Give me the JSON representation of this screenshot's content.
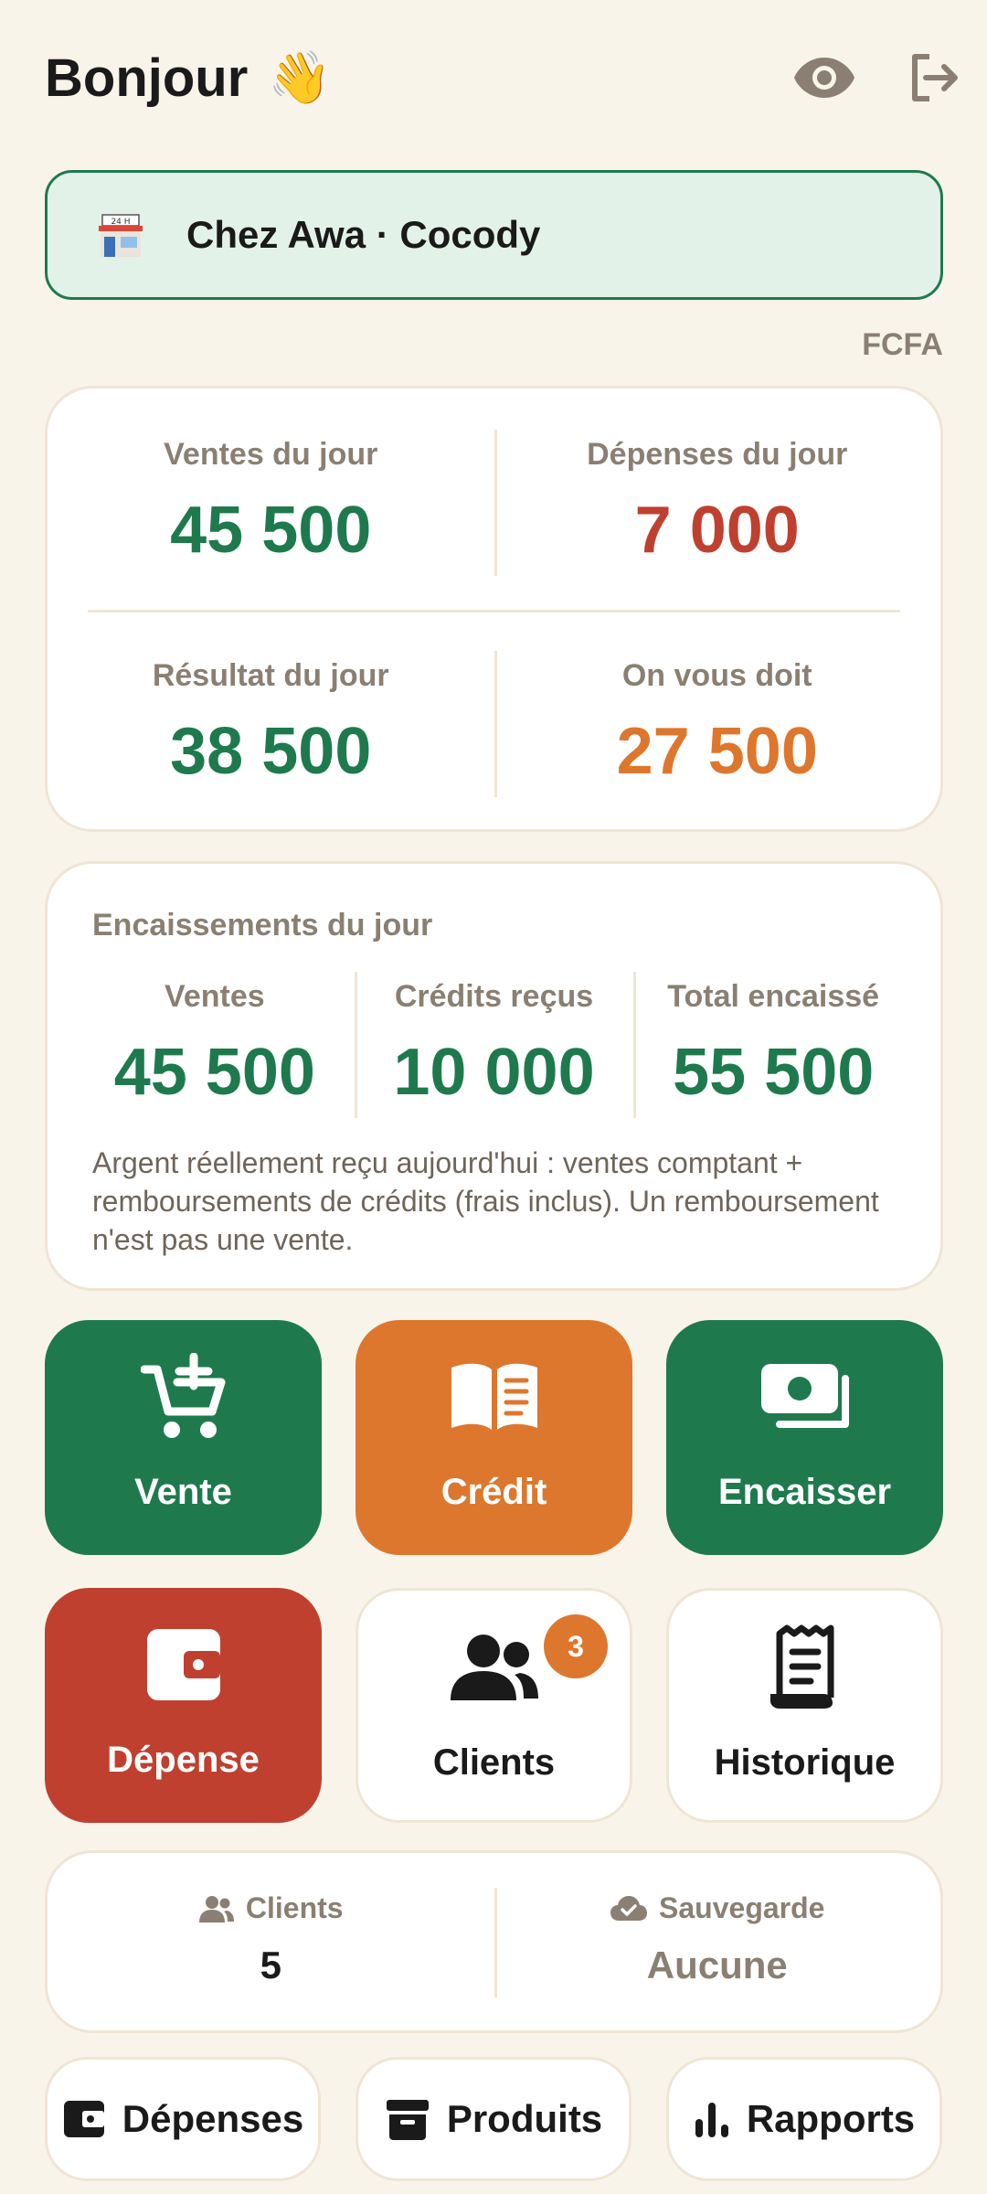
{
  "header": {
    "greeting": "Bonjour",
    "wave_emoji": "👋",
    "icons": [
      "eye-icon",
      "logout-icon"
    ]
  },
  "shop": {
    "icon": "store-icon",
    "name": "Chez Awa · Cocody"
  },
  "currency": "FCFA",
  "summary": {
    "sales": {
      "label": "Ventes du jour",
      "value": "45 500"
    },
    "expenses": {
      "label": "Dépenses du jour",
      "value": "7 000"
    },
    "result": {
      "label": "Résultat du jour",
      "value": "38 500"
    },
    "owed": {
      "label": "On vous doit",
      "value": "27 500"
    }
  },
  "encaissements": {
    "title": "Encaissements du jour",
    "items": [
      {
        "label": "Ventes",
        "value": "45 500"
      },
      {
        "label": "Crédits reçus",
        "value": "10 000"
      },
      {
        "label": "Total encaissé",
        "value": "55 500"
      }
    ],
    "note": "Argent réellement reçu aujourd'hui : ventes comptant + remboursements de crédits (frais inclus). Un remboursement n'est pas une vente."
  },
  "actions": {
    "vente": "Vente",
    "credit": "Crédit",
    "encaisser": "Encaisser",
    "depense": "Dépense",
    "clients": "Clients",
    "clients_badge": "3",
    "historique": "Historique"
  },
  "stats": {
    "clients": {
      "label": "Clients",
      "value": "5"
    },
    "backup": {
      "label": "Sauvegarde",
      "value": "Aucune"
    }
  },
  "bottom_nav": {
    "depenses": "Dépenses",
    "produits": "Produits",
    "rapports": "Rapports"
  },
  "colors": {
    "green": "#1e7a4d",
    "orange": "#dd772d",
    "red": "#c0402f",
    "background": "#f9f4ea"
  }
}
